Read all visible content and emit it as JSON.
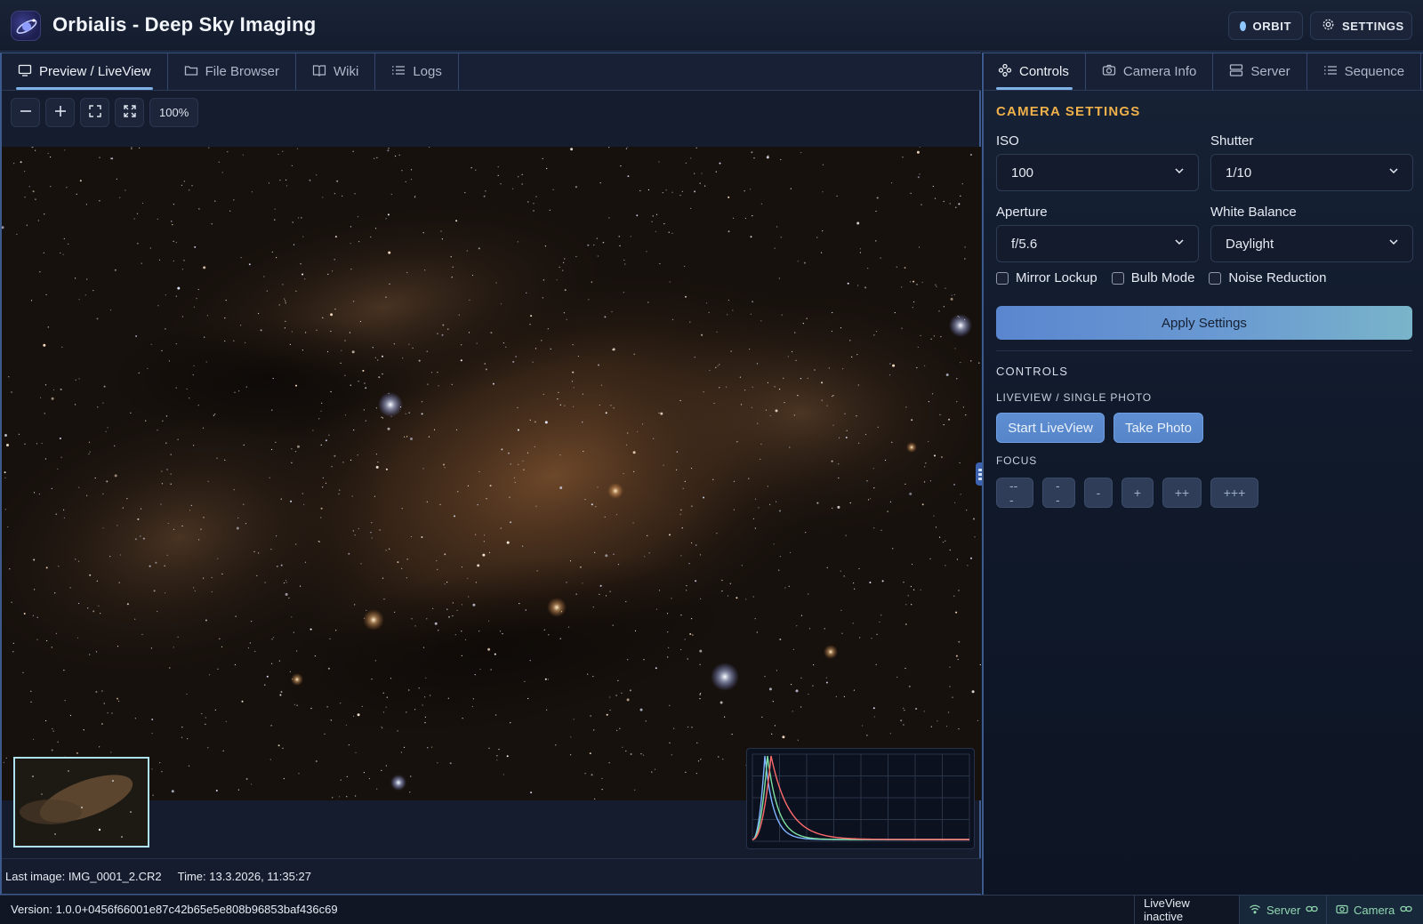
{
  "app": {
    "title": "Orbialis - Deep Sky Imaging",
    "orbit_label": "ORBIT",
    "settings_label": "SETTINGS"
  },
  "left_tabs": [
    {
      "label": "Preview / LiveView",
      "icon": "monitor-icon",
      "active": true
    },
    {
      "label": "File Browser",
      "icon": "folder-icon",
      "active": false
    },
    {
      "label": "Wiki",
      "icon": "book-icon",
      "active": false
    },
    {
      "label": "Logs",
      "icon": "list-icon",
      "active": false
    }
  ],
  "toolbar": {
    "zoom_level": "100%",
    "icons": [
      "zoom-out-icon",
      "zoom-in-icon",
      "fit-icon",
      "fullscreen-icon"
    ]
  },
  "preview": {
    "last_image_label": "Last image: IMG_0001_2.CR2",
    "time_label": "Time: 13.3.2026, 11:35:27"
  },
  "histogram_colors": {
    "red": "#ff6b6b",
    "green": "#7ee0a0",
    "blue": "#7fb4ff",
    "grid": "#2a3447"
  },
  "right_tabs": [
    {
      "label": "Controls",
      "icon": "controls-icon",
      "active": true
    },
    {
      "label": "Camera Info",
      "icon": "camera-icon",
      "active": false
    },
    {
      "label": "Server",
      "icon": "server-icon",
      "active": false
    },
    {
      "label": "Sequence",
      "icon": "list-icon",
      "active": false
    }
  ],
  "camera_settings": {
    "title": "CAMERA SETTINGS",
    "iso": {
      "label": "ISO",
      "value": "100"
    },
    "shutter": {
      "label": "Shutter",
      "value": "1/10"
    },
    "aperture": {
      "label": "Aperture",
      "value": "f/5.6"
    },
    "white_balance": {
      "label": "White Balance",
      "value": "Daylight"
    },
    "checkboxes": [
      {
        "label": "Mirror Lockup",
        "checked": false
      },
      {
        "label": "Bulb Mode",
        "checked": false
      },
      {
        "label": "Noise Reduction",
        "checked": false
      }
    ],
    "apply_label": "Apply Settings"
  },
  "controls": {
    "title": "CONTROLS",
    "liveview_title": "LIVEVIEW / SINGLE PHOTO",
    "start_liveview_label": "Start LiveView",
    "take_photo_label": "Take Photo",
    "focus_title": "FOCUS",
    "focus_buttons": [
      "---",
      "--",
      "-",
      "+",
      "++",
      "+++"
    ]
  },
  "footer": {
    "version": "Version: 1.0.0+0456f66001e87c42b65e5e808b96853baf436c69",
    "liveview_status": "LiveView inactive",
    "server_label": "Server",
    "camera_label": "Camera"
  },
  "colors": {
    "accent_orange": "#f0b14a",
    "accent_blue": "#7fb0e6",
    "status_green": "#92d8b0"
  }
}
